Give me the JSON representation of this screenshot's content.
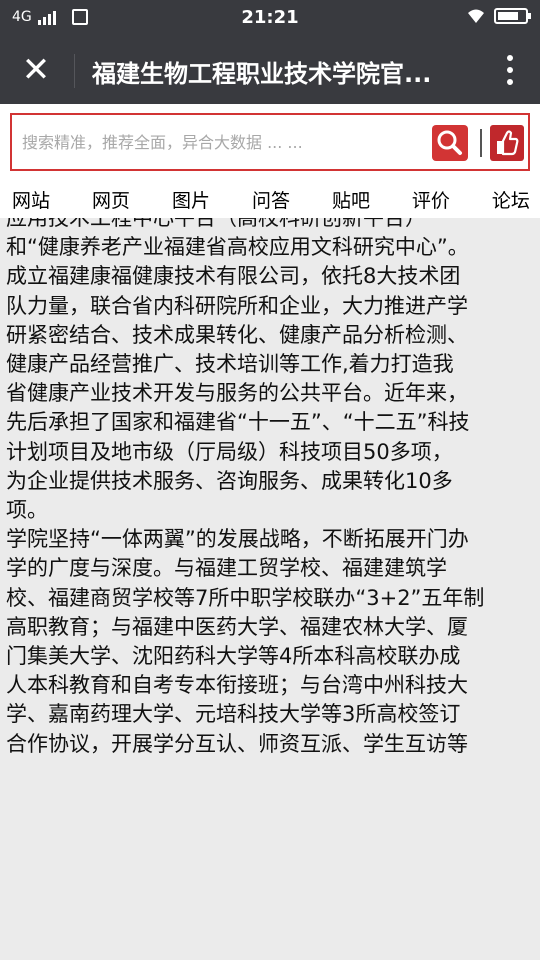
{
  "status_bar": {
    "network": "4G",
    "time": "21:21",
    "battery_level": 0.75
  },
  "title_bar": {
    "title": "福建生物工程职业技术学院官..."
  },
  "search": {
    "placeholder": "搜索精准，推荐全面，异合大数据 ... ..."
  },
  "tabs": [
    "网站",
    "网页",
    "图片",
    "问答",
    "贴吧",
    "评价",
    "论坛"
  ],
  "article": {
    "lines": [
      "应用技术工程中心平台（高校科研创新平台）",
      "和“健康养老产业福建省高校应用文科研究中心”。",
      "成立福建康福健康技术有限公司，依托8大技术团",
      "队力量，联合省内科研院所和企业，大力推进产学",
      "研紧密结合、技术成果转化、健康产品分析检测、",
      "健康产品经营推广、技术培训等工作,着力打造我",
      "省健康产业技术开发与服务的公共平台。近年来，",
      "先后承担了国家和福建省“十一五”、“十二五”科技",
      "计划项目及地市级（厅局级）科技项目50多项，",
      "为企业提供技术服务、咨询服务、成果转化10多",
      "项。",
      "学院坚持“一体两翼”的发展战略，不断拓展开门办",
      "学的广度与深度。与福建工贸学校、福建建筑学",
      "校、福建商贸学校等7所中职学校联办“3+2”五年制",
      "高职教育；与福建中医药大学、福建农林大学、厦",
      "门集美大学、沈阳药科大学等4所本科高校联办成",
      "人本科教育和自考专本衔接班；与台湾中州科技大",
      "学、嘉南药理大学、元培科技大学等3所高校签订",
      "合作协议，开展学分互认、师资互派、学生互访等"
    ]
  }
}
